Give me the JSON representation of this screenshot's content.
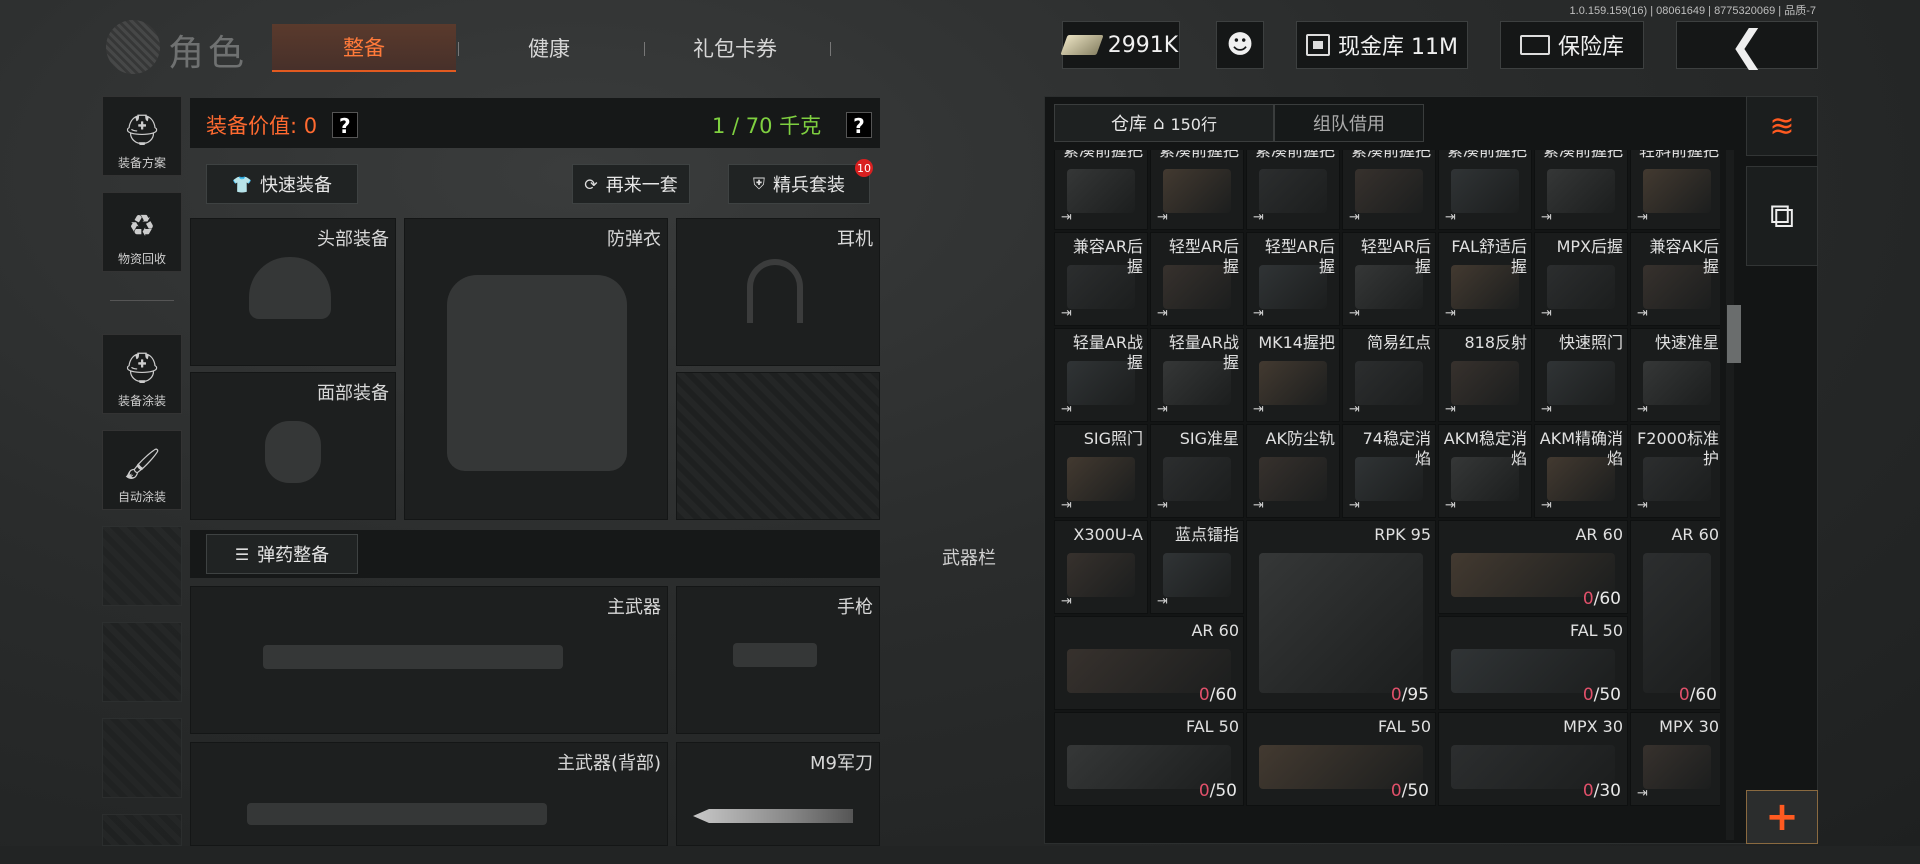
{
  "version_text": "1.0.159.159(16) | 08061649 | 8775320069 | 品质-7",
  "page_title": "角色",
  "main_tabs": [
    {
      "label": "整备",
      "active": true
    },
    {
      "label": "健康",
      "active": false
    },
    {
      "label": "礼包卡券",
      "active": false
    }
  ],
  "currency": {
    "cash": "2991K",
    "vault": "现金库 11M",
    "safe": "保险库"
  },
  "side_nav": [
    {
      "label": "装备方案"
    },
    {
      "label": "物资回收"
    },
    {
      "label": "装备涂装"
    },
    {
      "label": "自动涂装"
    }
  ],
  "equipment": {
    "value_label": "装备价值: 0",
    "weight_label": "1 / 70 千克",
    "help": "?",
    "quick_equip": "快速装备",
    "again": "再来一套",
    "elite_set": "精兵套装",
    "elite_badge": "10",
    "ammo_equip": "弹药整备",
    "weapon_bar": "武器栏",
    "slots": {
      "head": "头部装备",
      "armor": "防弹衣",
      "earphone": "耳机",
      "face": "面部装备",
      "primary": "主武器",
      "pistol": "手枪",
      "primary_back": "主武器(背部)",
      "knife": "M9军刀"
    }
  },
  "warehouse": {
    "tab_main": "仓库",
    "rows": "150行",
    "tab_team": "组队借用",
    "items": [
      {
        "name": "紧凑前握把"
      },
      {
        "name": "紧凑前握把"
      },
      {
        "name": "紧凑前握把"
      },
      {
        "name": "紧凑前握把"
      },
      {
        "name": "紧凑前握把"
      },
      {
        "name": "紧凑前握把"
      },
      {
        "name": "轻斜前握把"
      },
      {
        "name": "兼容AR后握"
      },
      {
        "name": "轻型AR后握"
      },
      {
        "name": "轻型AR后握"
      },
      {
        "name": "轻型AR后握"
      },
      {
        "name": "FAL舒适后握"
      },
      {
        "name": "MPX后握"
      },
      {
        "name": "兼容AK后握"
      },
      {
        "name": "轻量AR战握"
      },
      {
        "name": "轻量AR战握"
      },
      {
        "name": "MK14握把"
      },
      {
        "name": "简易红点"
      },
      {
        "name": "818反射"
      },
      {
        "name": "快速照门"
      },
      {
        "name": "快速准星"
      },
      {
        "name": "SIG照门"
      },
      {
        "name": "SIG准星"
      },
      {
        "name": "AK防尘轨"
      },
      {
        "name": "74稳定消焰"
      },
      {
        "name": "AKM稳定消焰"
      },
      {
        "name": "AKM精确消焰"
      },
      {
        "name": "F2000标准护"
      },
      {
        "name": "X300U-A"
      },
      {
        "name": "蓝点镭指"
      },
      {
        "name": "RPK 95",
        "qty": "/95"
      },
      {
        "name": "AR 60",
        "qty": "/60"
      },
      {
        "name": "AR 60",
        "qty": "/60"
      },
      {
        "name": "AR 60",
        "qty": "/60"
      },
      {
        "name": "FAL 50",
        "qty": "/50"
      },
      {
        "name": "FAL 50",
        "qty": "/50"
      },
      {
        "name": "FAL 50",
        "qty": "/50"
      },
      {
        "name": "MPX 30",
        "qty": "/30"
      },
      {
        "name": "MPX 30"
      }
    ],
    "zero": "0"
  },
  "colors": {
    "accent": "#ff6a30",
    "weight": "#7fd040",
    "zero_qty": "#e0506a"
  }
}
